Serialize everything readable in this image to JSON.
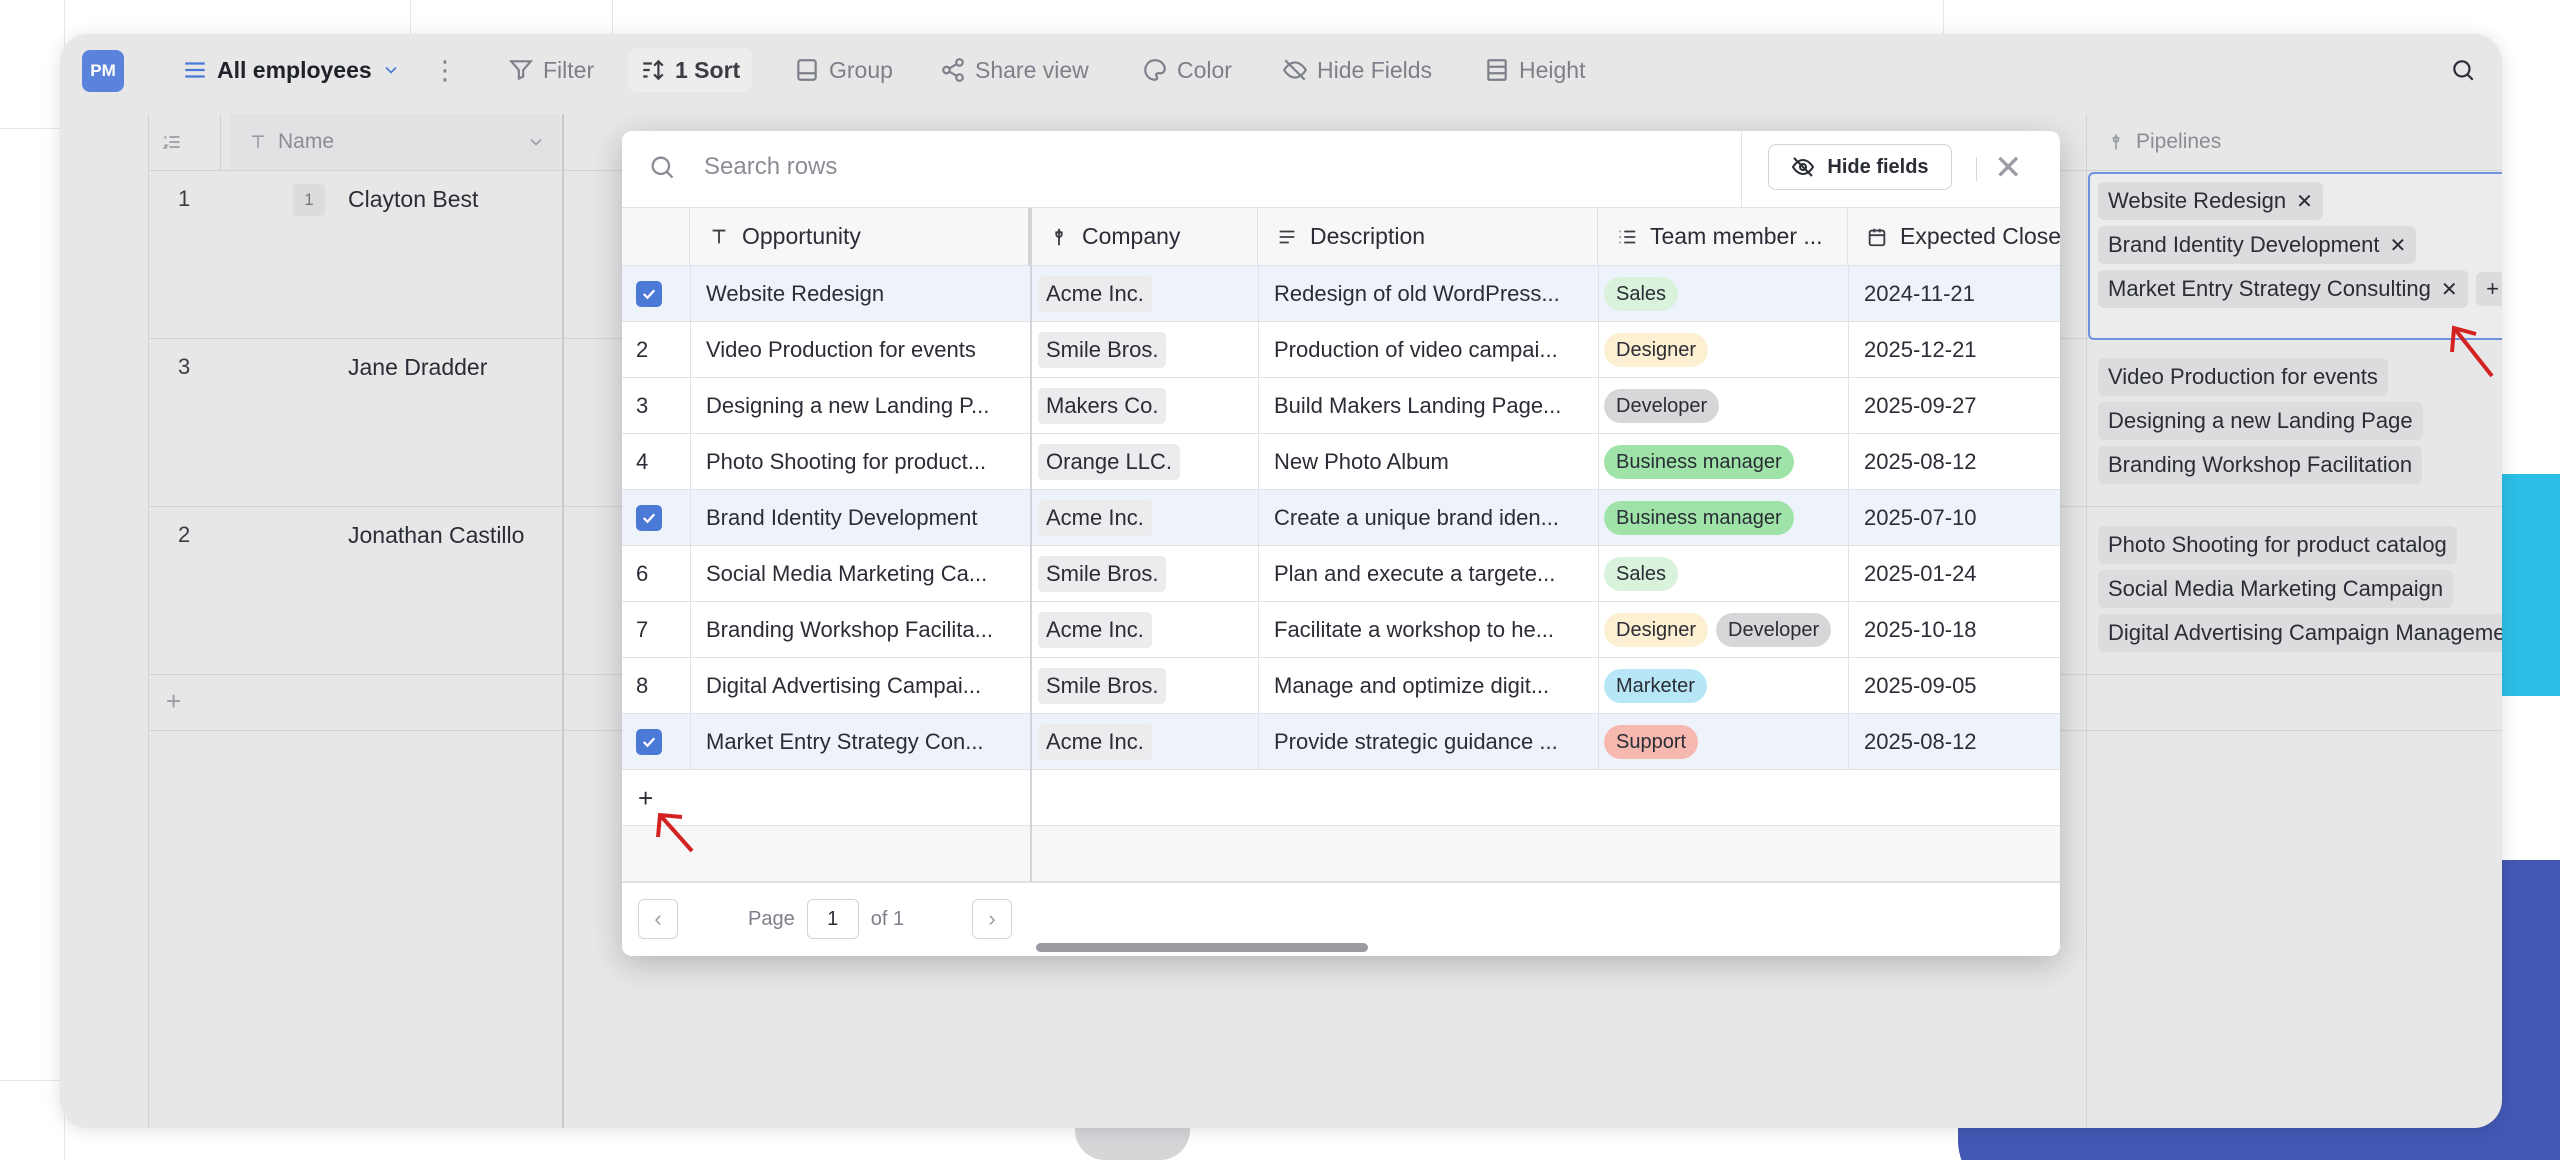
{
  "toolbar": {
    "badge": "PM",
    "view_name": "All employees",
    "filter": "Filter",
    "sort": "1 Sort",
    "group": "Group",
    "share": "Share view",
    "color": "Color",
    "hide_fields": "Hide Fields",
    "height": "Height"
  },
  "grid": {
    "columns": {
      "name": "Name",
      "pipelines": "Pipelines"
    },
    "rows": [
      {
        "num": "1",
        "count": "1",
        "name": "Clayton Best",
        "pipelines": [
          "Website Redesign",
          "Brand Identity Development",
          "Market Entry Strategy Consulting"
        ]
      },
      {
        "num": "3",
        "name": "Jane Dradder",
        "pipelines": [
          "Video Production for events",
          "Designing a new Landing Page",
          "Branding Workshop Facilitation"
        ]
      },
      {
        "num": "2",
        "name": "Jonathan Castillo",
        "pipelines": [
          "Photo Shooting for product catalog",
          "Social Media Marketing Campaign",
          "Digital Advertising Campaign Management"
        ]
      }
    ],
    "add_row": "+"
  },
  "modal": {
    "search_placeholder": "Search rows",
    "hide_fields": "Hide fields",
    "close": "✕",
    "columns": {
      "opportunity": "Opportunity",
      "company": "Company",
      "description": "Description",
      "team": "Team member ...",
      "expected": "Expected Close"
    },
    "rows": [
      {
        "num": "",
        "checked": true,
        "opportunity": "Website Redesign",
        "company": "Acme Inc.",
        "description": "Redesign of old WordPress...",
        "team": [
          "Sales"
        ],
        "date": "2024-11-21"
      },
      {
        "num": "2",
        "checked": false,
        "opportunity": "Video Production for events",
        "company": "Smile Bros.",
        "description": "Production of video campai...",
        "team": [
          "Designer"
        ],
        "date": "2025-12-21"
      },
      {
        "num": "3",
        "checked": false,
        "opportunity": "Designing a new Landing P...",
        "company": "Makers Co.",
        "description": "Build Makers Landing Page...",
        "team": [
          "Developer"
        ],
        "date": "2025-09-27"
      },
      {
        "num": "4",
        "checked": false,
        "opportunity": "Photo Shooting for product...",
        "company": "Orange LLC.",
        "description": "New Photo Album",
        "team": [
          "Business manager"
        ],
        "date": "2025-08-12"
      },
      {
        "num": "",
        "checked": true,
        "opportunity": "Brand Identity Development",
        "company": "Acme Inc.",
        "description": "Create a unique brand iden...",
        "team": [
          "Business manager"
        ],
        "date": "2025-07-10"
      },
      {
        "num": "6",
        "checked": false,
        "opportunity": "Social Media Marketing Ca...",
        "company": "Smile Bros.",
        "description": "Plan and execute a targete...",
        "team": [
          "Sales"
        ],
        "date": "2025-01-24"
      },
      {
        "num": "7",
        "checked": false,
        "opportunity": "Branding Workshop Facilita...",
        "company": "Acme Inc.",
        "description": "Facilitate a workshop to he...",
        "team": [
          "Designer",
          "Developer"
        ],
        "date": "2025-10-18"
      },
      {
        "num": "8",
        "checked": false,
        "opportunity": "Digital Advertising Campai...",
        "company": "Smile Bros.",
        "description": "Manage and optimize digit...",
        "team": [
          "Marketer"
        ],
        "date": "2025-09-05"
      },
      {
        "num": "",
        "checked": true,
        "opportunity": "Market Entry Strategy Con...",
        "company": "Acme Inc.",
        "description": "Provide strategic guidance ...",
        "team": [
          "Support"
        ],
        "date": "2025-08-12"
      }
    ],
    "add_row": "+",
    "pager": {
      "page_label": "Page",
      "page": "1",
      "of_label": "of 1"
    }
  },
  "tag_colors": {
    "Sales": "#d9f2dc",
    "Designer": "#fdf0d2",
    "Developer": "#d7d7da",
    "Business manager": "#9fe3a9",
    "Marketer": "#b7e7f6",
    "Support": "#f7b8b0"
  }
}
